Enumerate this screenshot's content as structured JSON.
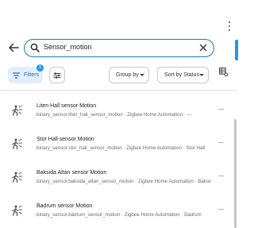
{
  "search": {
    "value": "Sensor_motion"
  },
  "toolbar": {
    "filters_label": "Filters",
    "filters_count": "1",
    "groupby_label": "Group by",
    "sortby_label": "Sort by Status"
  },
  "rows": [
    {
      "name": "Liten Hall sensor Motion",
      "entity": "binary_sensor.liten_hall_sensor_motion · Zigbee Home Automation · —",
      "status": "—"
    },
    {
      "name": "Stor Hall sensor Motion",
      "entity": "binary_sensor.stor_hall_sensor_motion · Zigbee Home Automation · Stor Hall",
      "status": "—"
    },
    {
      "name": "Baksida Altan sensor Motion",
      "entity": "binary_sensor.baksida_altan_sensor_motion · Zigbee Home Automation · Baksida",
      "status": "—"
    },
    {
      "name": "Badrum sensor Motion",
      "entity": "binary_sensor.badrum_sensor_motion · Zigbee Home Automation · Badrum",
      "status": "—"
    }
  ],
  "icons": {
    "back": "arrow-left-icon",
    "search": "magnify-icon",
    "clear": "close-icon",
    "filters": "filter-variant-icon",
    "tune": "tune-icon",
    "columns": "table-cog-icon",
    "row": "motion-sensor-icon",
    "menu": "dots-vertical-icon"
  },
  "colors": {
    "accent": "#2196f3",
    "search_border": "#1d78c8",
    "filter_bg": "#e3eefb"
  }
}
